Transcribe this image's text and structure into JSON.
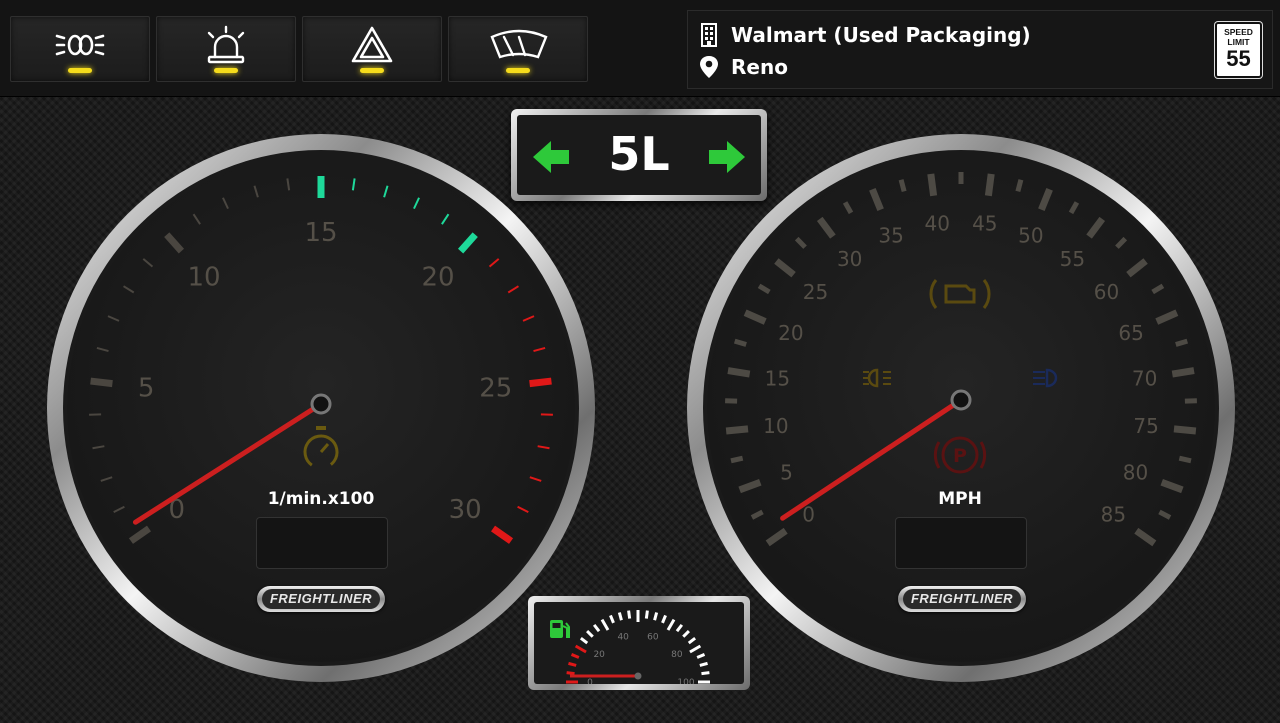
{
  "indicators": [
    {
      "name": "headlights-icon",
      "active": true,
      "led_color": "#f5dc1c"
    },
    {
      "name": "beacon-light-icon",
      "active": true,
      "led_color": "#f5dc1c"
    },
    {
      "name": "hazard-warning-icon",
      "active": true,
      "led_color": "#f5dc1c"
    },
    {
      "name": "wipers-icon",
      "active": true,
      "led_color": "#f5dc1c"
    }
  ],
  "job": {
    "company": "Walmart (Used Packaging)",
    "city": "Reno"
  },
  "speed_limit": {
    "line1": "SPEED",
    "line2": "LIMIT",
    "value": "55"
  },
  "gear": {
    "value": "5L",
    "left_blinker": "on",
    "right_blinker": "on",
    "blinker_color": "#2ec93a"
  },
  "tachometer": {
    "unit_label": "1/min.x100",
    "brand_badge": "FREIGHTLINER",
    "tick_labels": [
      "0",
      "5",
      "10",
      "15",
      "20",
      "25",
      "30"
    ],
    "max": 30,
    "needle_value": 0.3,
    "green_zone": [
      15,
      20
    ],
    "red_zone": [
      21,
      30
    ],
    "odometer_display": ""
  },
  "speedometer": {
    "unit_label": "MPH",
    "brand_badge": "FREIGHTLINER",
    "tick_labels": [
      "0",
      "5",
      "10",
      "15",
      "20",
      "25",
      "30",
      "35",
      "40",
      "45",
      "50",
      "55",
      "60",
      "65",
      "70",
      "75",
      "80",
      "85"
    ],
    "max": 85,
    "needle_value": 0.5,
    "odometer_display": "",
    "warning_icons": [
      "check-engine-icon",
      "parking-lights-icon",
      "high-beam-icon",
      "parking-brake-icon"
    ]
  },
  "fuel_gauge": {
    "tick_labels": [
      "0",
      "20",
      "40",
      "60",
      "80",
      "100"
    ],
    "level_fraction": 0.0,
    "icon": "fuel-pump-icon",
    "icon_color": "#2ec93a"
  },
  "colors": {
    "needle": "#cc1f1f",
    "tick_dim": "#4a4640",
    "label_dim": "#555048",
    "green": "#1ed99a",
    "red": "#e01818",
    "led": "#f5dc1c"
  }
}
